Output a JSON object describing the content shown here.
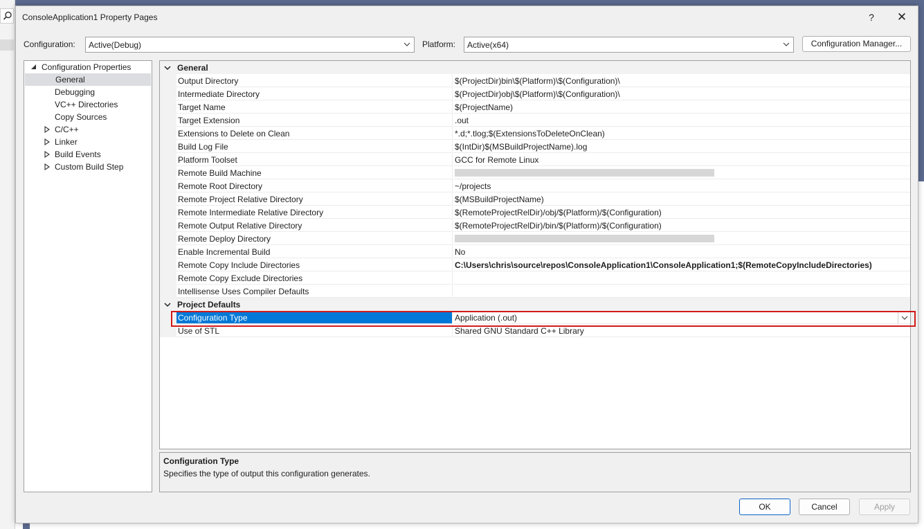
{
  "window": {
    "title": "ConsoleApplication1 Property Pages",
    "help_label": "?",
    "close_label": "✕"
  },
  "toolbar": {
    "configuration_label": "Configuration:",
    "configuration_value": "Active(Debug)",
    "platform_label": "Platform:",
    "platform_value": "Active(x64)",
    "config_manager_label": "Configuration Manager..."
  },
  "tree": {
    "root": "Configuration Properties",
    "items": [
      {
        "label": "General",
        "selected": true,
        "expandable": false
      },
      {
        "label": "Debugging",
        "expandable": false
      },
      {
        "label": "VC++ Directories",
        "expandable": false
      },
      {
        "label": "Copy Sources",
        "expandable": false
      },
      {
        "label": "C/C++",
        "expandable": true
      },
      {
        "label": "Linker",
        "expandable": true
      },
      {
        "label": "Build Events",
        "expandable": true
      },
      {
        "label": "Custom Build Step",
        "expandable": true
      }
    ]
  },
  "grid": {
    "categories": [
      {
        "name": "General",
        "rows": [
          {
            "name": "Output Directory",
            "value": "$(ProjectDir)bin\\$(Platform)\\$(Configuration)\\"
          },
          {
            "name": "Intermediate Directory",
            "value": "$(ProjectDir)obj\\$(Platform)\\$(Configuration)\\"
          },
          {
            "name": "Target Name",
            "value": "$(ProjectName)"
          },
          {
            "name": "Target Extension",
            "value": ".out"
          },
          {
            "name": "Extensions to Delete on Clean",
            "value": "*.d;*.tlog;$(ExtensionsToDeleteOnClean)"
          },
          {
            "name": "Build Log File",
            "value": "$(IntDir)$(MSBuildProjectName).log"
          },
          {
            "name": "Platform Toolset",
            "value": "GCC for Remote Linux"
          },
          {
            "name": "Remote Build Machine",
            "value": "",
            "obscured": true
          },
          {
            "name": "Remote Root Directory",
            "value": "~/projects"
          },
          {
            "name": "Remote Project Relative Directory",
            "value": "$(MSBuildProjectName)"
          },
          {
            "name": "Remote Intermediate Relative Directory",
            "value": "$(RemoteProjectRelDir)/obj/$(Platform)/$(Configuration)"
          },
          {
            "name": "Remote Output Relative Directory",
            "value": "$(RemoteProjectRelDir)/bin/$(Platform)/$(Configuration)"
          },
          {
            "name": "Remote Deploy Directory",
            "value": "",
            "obscured": true
          },
          {
            "name": "Enable Incremental Build",
            "value": "No"
          },
          {
            "name": "Remote Copy Include Directories",
            "value": "C:\\Users\\chris\\source\\repos\\ConsoleApplication1\\ConsoleApplication1;$(RemoteCopyIncludeDirectories)",
            "bold": true
          },
          {
            "name": "Remote Copy Exclude Directories",
            "value": ""
          },
          {
            "name": "Intellisense Uses Compiler Defaults",
            "value": ""
          }
        ]
      },
      {
        "name": "Project Defaults",
        "rows": [
          {
            "name": "Configuration Type",
            "value": "Application (.out)",
            "selected": true
          },
          {
            "name": "Use of STL",
            "value": "Shared GNU Standard C++ Library"
          }
        ]
      }
    ]
  },
  "description": {
    "title": "Configuration Type",
    "text": "Specifies the type of output this configuration generates."
  },
  "buttons": {
    "ok": "OK",
    "cancel": "Cancel",
    "apply": "Apply"
  },
  "colors": {
    "selection": "#0078d7",
    "highlight_box": "#d11a1a"
  }
}
